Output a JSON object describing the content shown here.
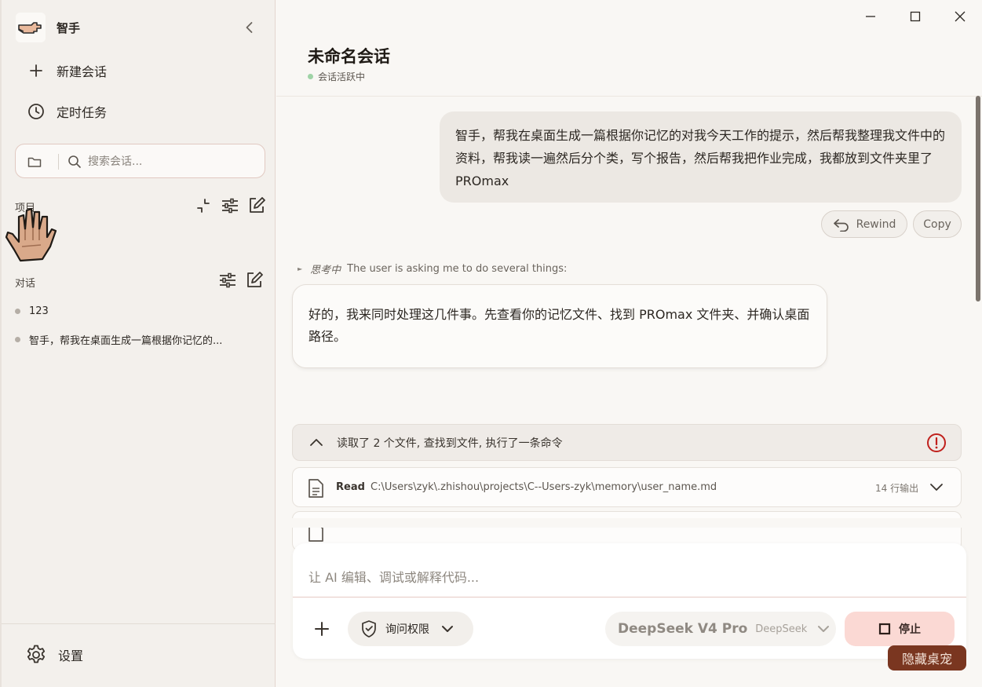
{
  "sidebar": {
    "app_name": "智手",
    "nav": [
      {
        "label": "新建会话",
        "icon": "plus-icon"
      },
      {
        "label": "定时任务",
        "icon": "clock-icon"
      }
    ],
    "search": {
      "placeholder": "搜索会话..."
    },
    "projects_label": "项目",
    "conversations_label": "对话",
    "conversations": [
      {
        "title": "123"
      },
      {
        "title": "智手，帮我在桌面生成一篇根据你记忆的..."
      }
    ],
    "settings_label": "设置"
  },
  "window": {
    "controls": [
      "minimize-icon",
      "maximize-icon",
      "close-icon"
    ]
  },
  "chat": {
    "title": "未命名会话",
    "status": "会话活跃中",
    "status_color": "#9fd3a6",
    "user_message": "智手，帮我在桌面生成一篇根据你记忆的对我今天工作的提示，然后帮我整理我文件中的资料，帮我读一遍然后分个类，写个报告，然后帮我把作业完成，我都放到文件夹里了PROmax",
    "rewind_label": "Rewind",
    "copy_label": "Copy",
    "thinking_label": "思考中",
    "thinking_text": "The user is asking me to do several things:",
    "assistant_message": "好的，我来同时处理这几件事。先查看你的记忆文件、找到 PROmax 文件夹、并确认桌面路径。",
    "tools_summary": "读取了 2 个文件, 查找到文件, 执行了一条命令",
    "error_color": "#c0201c",
    "tool_calls": [
      {
        "name": "Read",
        "path": "C:\\Users\\zyk\\.zhishou\\projects\\C--Users-zyk\\memory\\user_name.md",
        "output": "14 行输出"
      }
    ]
  },
  "composer": {
    "placeholder": "让 AI 编辑、调试或解释代码...",
    "permission_label": "询问权限",
    "model_name": "DeepSeek V4 Pro",
    "model_provider": "DeepSeek",
    "stop_label": "停止"
  },
  "hide_pet_label": "隐藏桌宠",
  "colors": {
    "accent": "#7a3620",
    "stop_bg": "#fbd9d4",
    "sidebar_bg": "#f3f0ec"
  }
}
